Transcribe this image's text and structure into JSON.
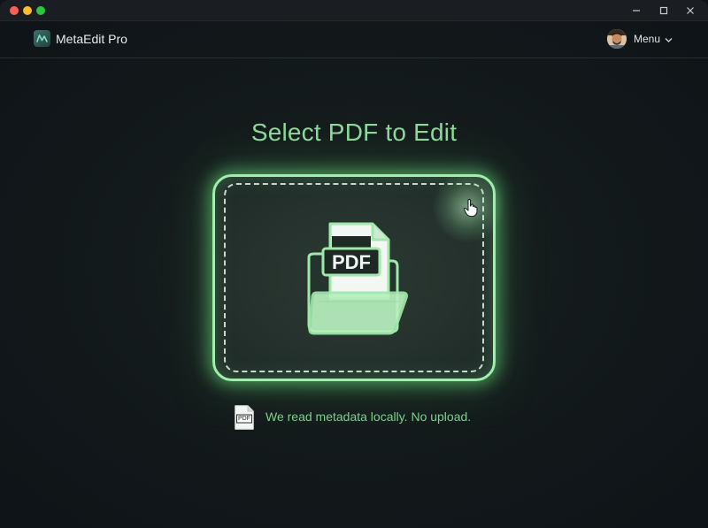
{
  "window": {
    "controls": [
      "close",
      "minimize",
      "maximize"
    ],
    "right_controls": [
      "minimize-icon",
      "maximize-icon",
      "close-icon"
    ]
  },
  "header": {
    "app_name": "MetaEdit Pro",
    "logo_icon": "app-logo-icon",
    "menu_label": "Menu",
    "menu_icon": "chevron-down-icon",
    "avatar_icon": "user-avatar"
  },
  "main": {
    "title": "Select PDF to Edit",
    "dropzone": {
      "badge_text": "PDF",
      "icon": "pdf-folder-icon",
      "cursor_icon": "hand-pointer-icon"
    },
    "note": {
      "icon_label": "PDF",
      "icon": "pdf-file-icon",
      "text": "We read metadata locally. No upload."
    }
  },
  "colors": {
    "accent": "#8ed99b",
    "glow": "#9ef0aa",
    "background": "#0f1418",
    "titlebar": "#1a1e22"
  }
}
